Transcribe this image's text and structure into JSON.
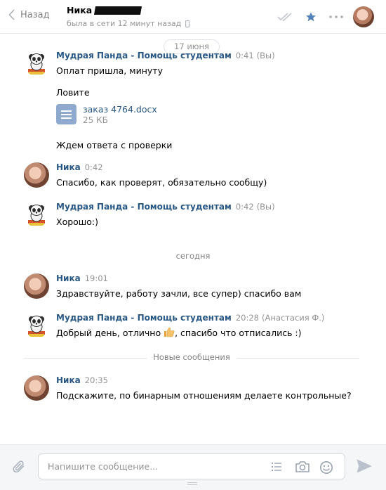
{
  "header": {
    "back_label": "Назад",
    "peer_name": "Ника",
    "peer_status": "была в сети 12 минут назад"
  },
  "date_divider": "17 июня",
  "messages": [
    {
      "author": "Мудрая Панда - Помощь студентам",
      "time": "0:41",
      "extra": "(Вы)",
      "lines": [
        "Оплат пришла, минуту",
        "Ловите"
      ],
      "attachment": {
        "name": "заказ 4764.docx",
        "size": "25 КБ"
      },
      "after": "Ждем ответа с проверки"
    },
    {
      "author": "Ника",
      "time": "0:42",
      "text": "Спасибо, как проверят, обязательно сообщу)"
    },
    {
      "author": "Мудрая Панда - Помощь студентам",
      "time": "0:42",
      "extra": "(Вы)",
      "text": "Хорошо:)"
    },
    {
      "author": "Ника",
      "time": "19:01",
      "text": "Здравствуйте, работу зачли, все супер) спасибо вам"
    },
    {
      "author": "Мудрая Панда - Помощь студентам",
      "time": "20:28",
      "extra": "(Анастасия Ф.)",
      "text_before": "Добрый день, отлично",
      "text_after": ", спасибо что отписались :)"
    },
    {
      "author": "Ника",
      "time": "20:35",
      "text": "Подскажите, по бинарным отношениям делаете контрольные?"
    }
  ],
  "today_label": "сегодня",
  "new_messages_label": "Новые сообщения",
  "composer": {
    "placeholder": "Напишите сообщение..."
  },
  "colors": {
    "link": "#2a5885",
    "accent": "#5181b8",
    "muted": "#939393"
  },
  "icons": [
    "chevron-left-icon",
    "phone-icon",
    "double-check-icon",
    "star-icon",
    "more-icon",
    "document-icon",
    "paperclip-icon",
    "list-icon",
    "camera-icon",
    "smile-icon",
    "send-icon",
    "thumbs-up-emoji"
  ]
}
